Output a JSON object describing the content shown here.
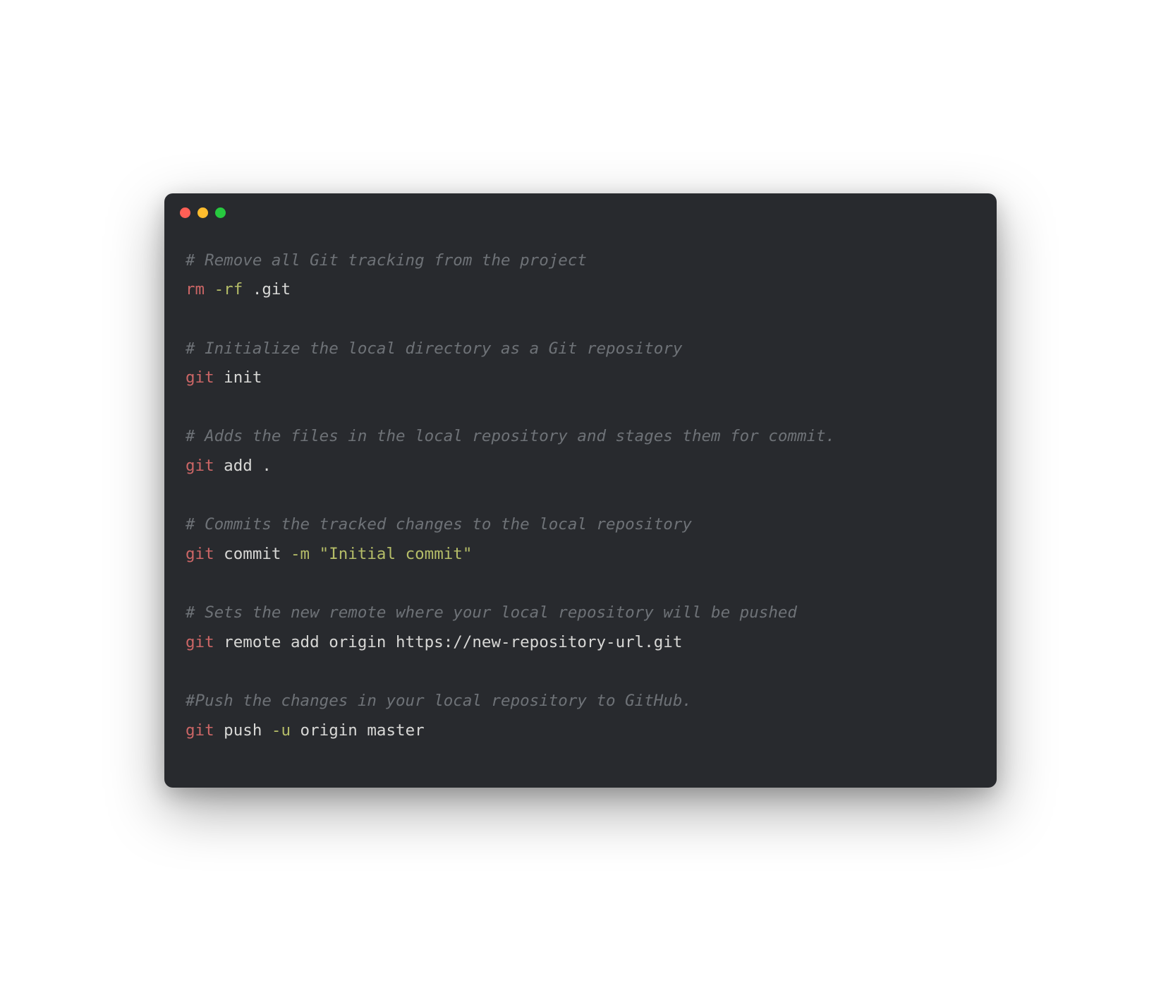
{
  "traffic_lights": {
    "red": "#ff5f56",
    "yellow": "#ffbd2e",
    "green": "#27c93f"
  },
  "code": {
    "c1": "# Remove all Git tracking from the project",
    "l1a": "rm",
    "l1b": " -rf",
    "l1c": " .git",
    "c2": "# Initialize the local directory as a Git repository",
    "l2a": "git",
    "l2b": " init",
    "c3": "# Adds the files in the local repository and stages them for commit.",
    "l3a": "git",
    "l3b": " add .",
    "c4": "# Commits the tracked changes to the local repository",
    "l4a": "git",
    "l4b": " commit ",
    "l4c": "-m",
    "l4d": " ",
    "l4e": "\"Initial commit\"",
    "c5": "# Sets the new remote where your local repository will be pushed",
    "l5a": "git",
    "l5b": " remote add origin https://new-repository-url.git",
    "c6": "#Push the changes in your local repository to GitHub.",
    "l6a": "git",
    "l6b": " push ",
    "l6c": "-u",
    "l6d": " origin master"
  }
}
